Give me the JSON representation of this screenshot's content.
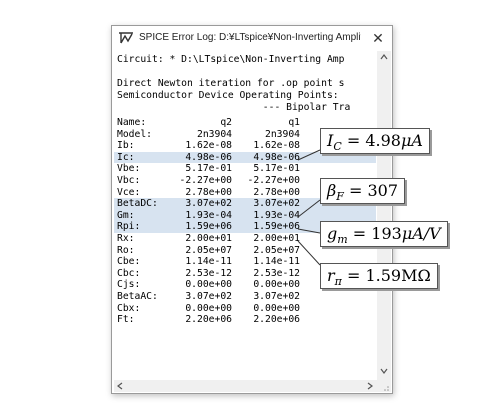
{
  "window": {
    "title": "SPICE Error Log: D:¥LTspice¥Non-Inverting Amplifi...",
    "close_label": "✕"
  },
  "log": {
    "circuit_line": "Circuit: * D:\\LTspice\\Non-Inverting Amp",
    "newton_line": "Direct Newton iteration for .op point s",
    "semi_line": "Semiconductor Device Operating Points:",
    "bipolar_line": "                         --- Bipolar Tra",
    "rows": [
      {
        "name": "Name:",
        "q2": "q2",
        "q1": "q1",
        "hl": false
      },
      {
        "name": "Model:",
        "q2": "2n3904",
        "q1": "2n3904",
        "hl": false
      },
      {
        "name": "Ib:",
        "q2": "1.62e-08",
        "q1": "1.62e-08",
        "hl": false
      },
      {
        "name": "Ic:",
        "q2": "4.98e-06",
        "q1": "4.98e-06",
        "hl": true
      },
      {
        "name": "Vbe:",
        "q2": "5.17e-01",
        "q1": "5.17e-01",
        "hl": false
      },
      {
        "name": "Vbc:",
        "q2": "-2.27e+00",
        "q1": "-2.27e+00",
        "hl": false
      },
      {
        "name": "Vce:",
        "q2": "2.78e+00",
        "q1": "2.78e+00",
        "hl": false
      },
      {
        "name": "BetaDC:",
        "q2": "3.07e+02",
        "q1": "3.07e+02",
        "hl": true
      },
      {
        "name": "Gm:",
        "q2": "1.93e-04",
        "q1": "1.93e-04",
        "hl": true
      },
      {
        "name": "Rpi:",
        "q2": "1.59e+06",
        "q1": "1.59e+06",
        "hl": true
      },
      {
        "name": "Rx:",
        "q2": "2.00e+01",
        "q1": "2.00e+01",
        "hl": false
      },
      {
        "name": "Ro:",
        "q2": "2.05e+07",
        "q1": "2.05e+07",
        "hl": false
      },
      {
        "name": "Cbe:",
        "q2": "1.14e-11",
        "q1": "1.14e-11",
        "hl": false
      },
      {
        "name": "Cbc:",
        "q2": "2.53e-12",
        "q1": "2.53e-12",
        "hl": false
      },
      {
        "name": "Cjs:",
        "q2": "0.00e+00",
        "q1": "0.00e+00",
        "hl": false
      },
      {
        "name": "BetaAC:",
        "q2": "3.07e+02",
        "q1": "3.07e+02",
        "hl": false
      },
      {
        "name": "Cbx:",
        "q2": "0.00e+00",
        "q1": "0.00e+00",
        "hl": false
      },
      {
        "name": "Ft:",
        "q2": "2.20e+06",
        "q1": "2.20e+06",
        "hl": false
      }
    ]
  },
  "annotations": {
    "ic": {
      "sym": "I",
      "sub": "C",
      "rest": " = 4.98",
      "unit": "μA"
    },
    "bf": {
      "sym": "β",
      "sub": "F",
      "rest": " = 307",
      "unit": ""
    },
    "gm": {
      "sym": "g",
      "sub": "m",
      "rest": " = 193",
      "unit": "μA/V"
    },
    "rpi": {
      "sym": "r",
      "sub": "π",
      "rest": " = 1.59",
      "unit": "MΩ"
    }
  },
  "colors": {
    "highlight": "#d7e3f0",
    "callout_border": "#555555"
  },
  "icons": [
    "ltspice-app-icon",
    "close-icon",
    "scroll-up-icon",
    "scroll-down-icon",
    "scroll-left-icon",
    "scroll-right-icon",
    "resize-grip-icon"
  ]
}
